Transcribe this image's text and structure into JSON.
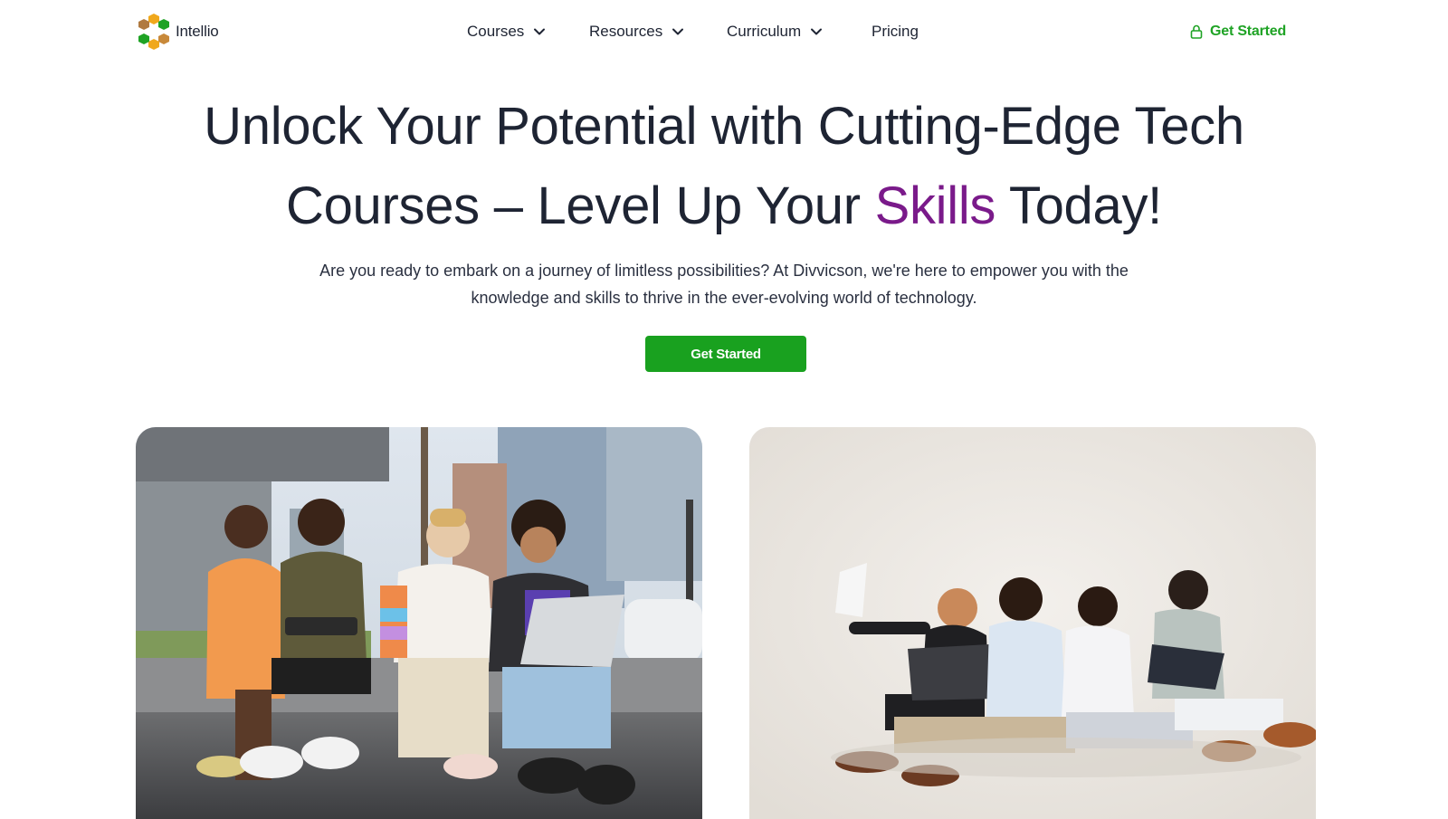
{
  "brand": {
    "name": "Intellio"
  },
  "nav": {
    "items": [
      {
        "label": "Courses",
        "has_dropdown": true
      },
      {
        "label": "Resources",
        "has_dropdown": true
      },
      {
        "label": "Curriculum",
        "has_dropdown": true
      },
      {
        "label": "Pricing",
        "has_dropdown": false
      }
    ],
    "cta_label": "Get Started"
  },
  "hero": {
    "title_line1": "Unlock Your Potential with Cutting-Edge Tech",
    "title_line2_before": "Courses – Level Up Your ",
    "title_line2_accent": "Skills",
    "title_line2_after": " Today!",
    "subtitle_line1": "Are you ready to embark on a journey of limitless possibilities? At Divvicson, we're here to empower you with the",
    "subtitle_line2": "knowledge and skills to thrive in the ever-evolving world of technology.",
    "cta_label": "Get Started"
  },
  "colors": {
    "accent_purple": "#7a1a8a",
    "brand_green": "#19a11f",
    "text_dark": "#1e2433"
  },
  "icons": {
    "logo": "intellio-logo-icon",
    "dropdown": "chevron-down-icon",
    "cta": "lock-icon"
  }
}
